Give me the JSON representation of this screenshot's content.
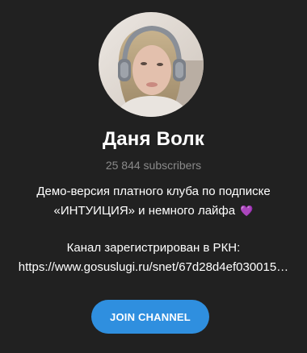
{
  "channel": {
    "name": "Даня Волк",
    "subscribers": "25 844 subscribers",
    "description": {
      "line1": "Демо-версия платного клуба по подписке",
      "line2": "«ИНТУИЦИЯ» и немного лайфа",
      "line2_emoji": "💜",
      "line3": "Канал зарегистрирован в РКН:",
      "line4": "https://www.gosuslugi.ru/snet/67d28d4ef030015…"
    },
    "avatar_icon": "profile-photo"
  },
  "actions": {
    "join_label": "JOIN CHANNEL"
  },
  "colors": {
    "background": "#212121",
    "accent": "#2f8fdf",
    "muted_text": "#8a8a8a"
  }
}
